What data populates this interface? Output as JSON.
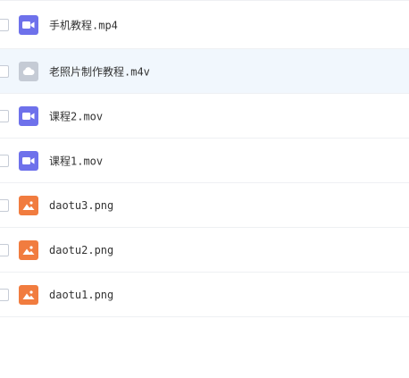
{
  "files": [
    {
      "name": "手机教程.mp4",
      "type": "video-icon",
      "icon_color": "#6e71eb",
      "selected": false
    },
    {
      "name": "老照片制作教程.m4v",
      "type": "cloud-icon",
      "icon_color": "#c5cbd5",
      "selected": false
    },
    {
      "name": "课程2.mov",
      "type": "video-icon",
      "icon_color": "#6e71eb",
      "selected": false
    },
    {
      "name": "课程1.mov",
      "type": "video-icon",
      "icon_color": "#6e71eb",
      "selected": false
    },
    {
      "name": "daotu3.png",
      "type": "image-icon",
      "icon_color": "#f17c3f",
      "selected": false
    },
    {
      "name": "daotu2.png",
      "type": "image-icon",
      "icon_color": "#f17c3f",
      "selected": false
    },
    {
      "name": "daotu1.png",
      "type": "image-icon",
      "icon_color": "#f17c3f",
      "selected": false
    }
  ],
  "colors": {
    "row_hover": "#f1f7fd",
    "divider": "#eef0f3",
    "text": "#333333"
  }
}
